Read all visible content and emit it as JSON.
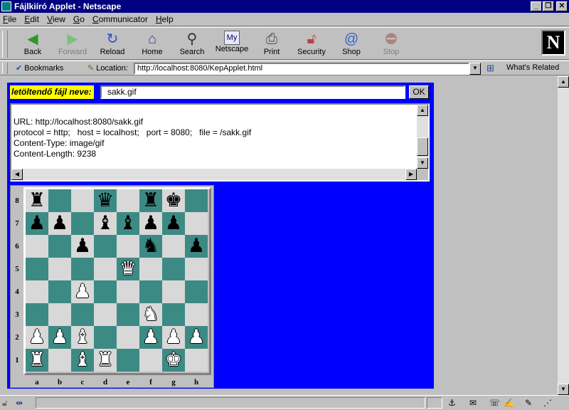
{
  "window": {
    "title": "Fájlkiíró Applet - Netscape"
  },
  "menu": [
    {
      "label": "File",
      "u": "F",
      "rest": "ile"
    },
    {
      "label": "Edit",
      "u": "E",
      "rest": "dit"
    },
    {
      "label": "View",
      "u": "V",
      "rest": "iew"
    },
    {
      "label": "Go",
      "u": "G",
      "rest": "o"
    },
    {
      "label": "Communicator",
      "u": "C",
      "rest": "ommunicator"
    },
    {
      "label": "Help",
      "u": "H",
      "rest": "elp"
    }
  ],
  "toolbar": {
    "back": "Back",
    "forward": "Forward",
    "reload": "Reload",
    "home": "Home",
    "search": "Search",
    "netscape": "Netscape",
    "print": "Print",
    "security": "Security",
    "shop": "Shop",
    "stop": "Stop",
    "logo": "N"
  },
  "locationbar": {
    "bookmarks": "Bookmarks",
    "location_label": "Location:",
    "url": "http://localhost:8080/KepApplet.html",
    "related": "What's Related"
  },
  "applet": {
    "filename_label": "letöltendő fájl neve:",
    "filename_value": "sakk.gif",
    "ok_label": "OK",
    "info_lines": [
      "URL: http://localhost:8080/sakk.gif",
      "protocol = http;   host = localhost;   port = 8080;   file = /sakk.gif",
      "Content-Type: image/gif",
      "Content-Length: 9238"
    ]
  },
  "chess": {
    "ranks": [
      "8",
      "7",
      "6",
      "5",
      "4",
      "3",
      "2",
      "1"
    ],
    "files": [
      "a",
      "b",
      "c",
      "d",
      "e",
      "f",
      "g",
      "h"
    ],
    "rows": [
      [
        "r",
        "",
        "",
        "q",
        "",
        "r",
        "k",
        ""
      ],
      [
        "p",
        "p",
        "",
        "b",
        "b",
        "p",
        "p",
        ""
      ],
      [
        "",
        "",
        "p",
        "",
        "",
        "n",
        "",
        "p"
      ],
      [
        "",
        "",
        "",
        "",
        "Q",
        "",
        "",
        ""
      ],
      [
        "",
        "",
        "P",
        "",
        "",
        "",
        "",
        ""
      ],
      [
        "",
        "",
        "",
        "",
        "",
        "N",
        "",
        ""
      ],
      [
        "P",
        "P",
        "B",
        "",
        "",
        "P",
        "P",
        "P"
      ],
      [
        "R",
        "",
        "B",
        "R",
        "",
        "",
        "K",
        ""
      ]
    ],
    "light_color": "#d8d8d8",
    "dark_color": "#3c8a84"
  },
  "colors": {
    "applet_bg": "#0000ff",
    "label_bg": "#ffff00",
    "titlebar": "#000080"
  }
}
